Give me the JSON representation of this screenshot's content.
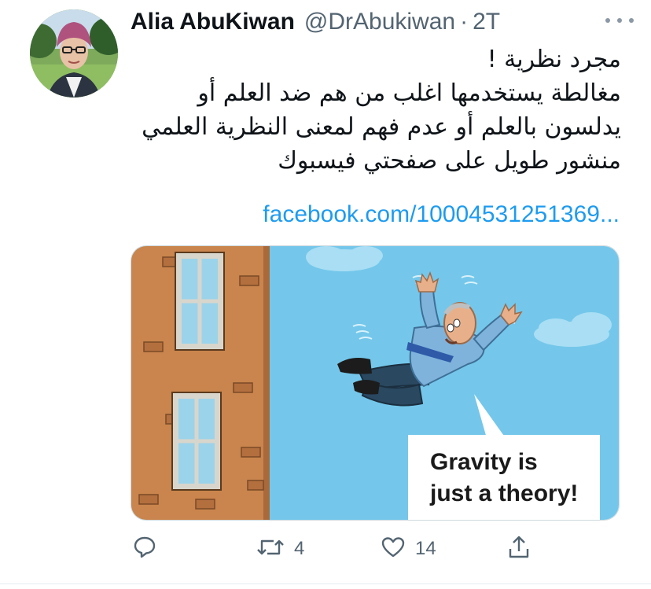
{
  "tweet": {
    "author_name": "Alia AbuKiwan",
    "handle": "@DrAbukiwan",
    "separator": "·",
    "time": "2T",
    "text_lines": [
      "مجرد نظرية !",
      "مغالطة يستخدمها اغلب من هم ضد العلم أو",
      "يدلسون بالعلم أو عدم فهم لمعنى النظرية العلمي",
      "منشور طويل على صفحتي فيسبوك"
    ],
    "link": "facebook.com/10004531251369..."
  },
  "media": {
    "speech_bubble_lines": [
      "Gravity is",
      "just a theory!"
    ]
  },
  "actions": {
    "reply_count": "",
    "retweet_count": "4",
    "like_count": "14"
  },
  "icons": {
    "more": "more-icon",
    "reply": "reply-icon",
    "retweet": "retweet-icon",
    "like": "heart-icon",
    "share": "share-icon"
  },
  "colors": {
    "link": "#1d9bf0",
    "secondary_text": "#536471",
    "sky": "#74c7ea",
    "building": "#c9854d"
  }
}
